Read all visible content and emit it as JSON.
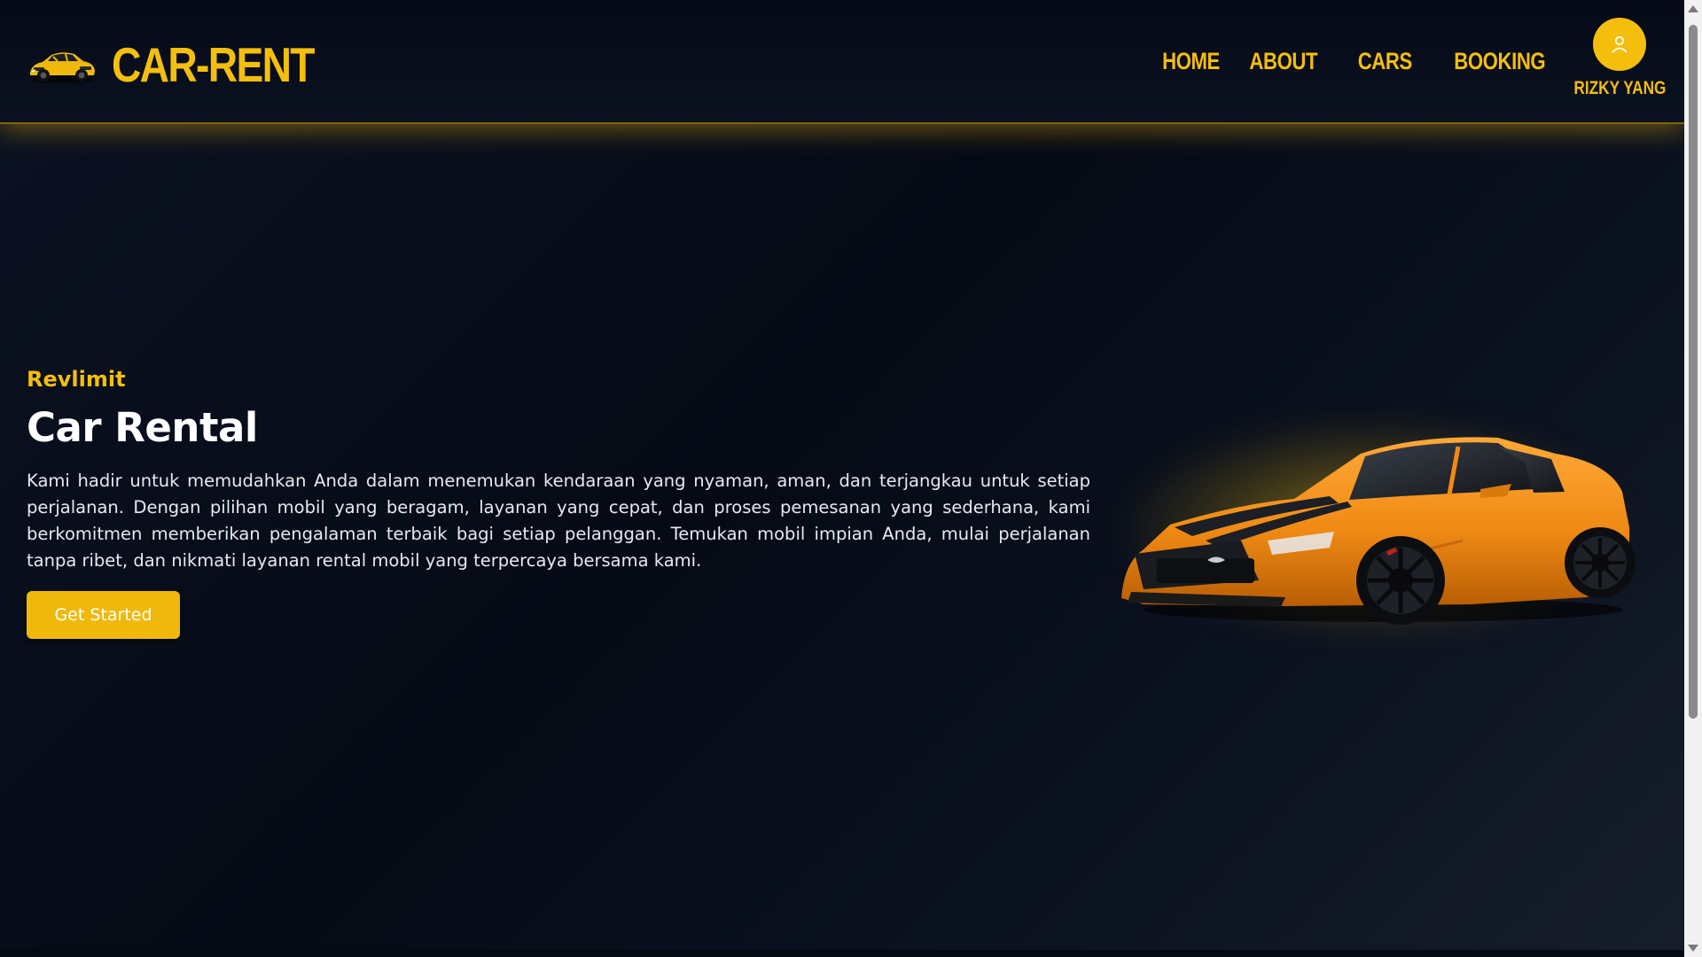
{
  "brand": {
    "name": "CAR-RENT",
    "logo_icon": "sports-car-icon"
  },
  "nav": {
    "items": [
      {
        "label": "HOME"
      },
      {
        "label": "ABOUT"
      },
      {
        "label": "CARS"
      },
      {
        "label": "BOOKING"
      }
    ]
  },
  "user": {
    "name": "RIZKY YANG",
    "avatar_icon": "user-icon"
  },
  "hero": {
    "tagline": "Revlimit",
    "title": "Car Rental",
    "description": "Kami hadir untuk memudahkan Anda dalam menemukan kendaraan yang nyaman, aman, dan terjangkau untuk setiap perjalanan. Dengan pilihan mobil yang beragam, layanan yang cepat, dan proses pemesanan yang sederhana, kami berkomitmen memberikan pengalaman terbaik bagi setiap pelanggan. Temukan mobil impian Anda, mulai perjalanan tanpa ribet, dan nikmati layanan rental mobil yang terpercaya bersama kami.",
    "cta_label": "Get Started",
    "image_icon": "orange-sports-car-image"
  },
  "colors": {
    "accent": "#f4be0c",
    "background": "#060b16",
    "text": "#ffffff"
  }
}
